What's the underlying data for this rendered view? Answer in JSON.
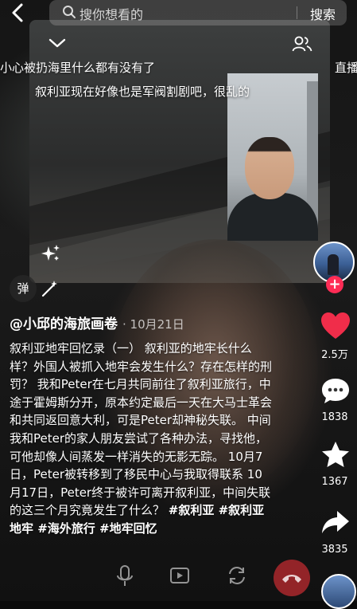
{
  "search": {
    "placeholder": "搜你想看的",
    "button_label": "搜索"
  },
  "overlay": {
    "comment_line": "小心被扔海里什么都有没有了",
    "live_label": "直播",
    "caption": "叙利亚现在好像也是军阀割剧吧，很乱的",
    "danmu_label": "弹"
  },
  "rail": {
    "like_count": "2.5万",
    "comment_count": "1838",
    "favorite_count": "1367",
    "share_count": "3835"
  },
  "post": {
    "author": "@小邱的海旅画卷",
    "date": "· 10月21日",
    "description": "叙利亚地牢回忆录（一） 叙利亚的地牢长什么样？外国人被抓入地牢会发生什么？存在怎样的刑罚？ 我和Peter在七月共同前往了叙利亚旅行，中途于霍姆斯分开，原本约定最后一天在大马士革会和共同返回意大利，可是Peter却神秘失联。 中间我和Peter的家人朋友尝试了各种办法，寻找他，可他却像人间蒸发一样消失的无影无踪。 10月7日，Peter被转移到了移民中心与我取得联系 10月17日，Peter终于被许可离开叙利亚，中间失联的这三个月究竟发生了什么？",
    "hashtags": "#叙利亚 #叙利亚地牢 #海外旅行 #地牢回忆"
  },
  "colors": {
    "accent_red": "#fe2c55",
    "like_red": "#f02d4a"
  },
  "icons": [
    "back-arrow-icon",
    "search-icon",
    "chevron-down-icon",
    "people-icon",
    "sparkle-icon",
    "wand-icon",
    "heart-icon",
    "comment-icon",
    "star-icon",
    "share-icon",
    "mic-icon",
    "screen-share-icon",
    "camera-flip-icon",
    "hangup-icon"
  ]
}
